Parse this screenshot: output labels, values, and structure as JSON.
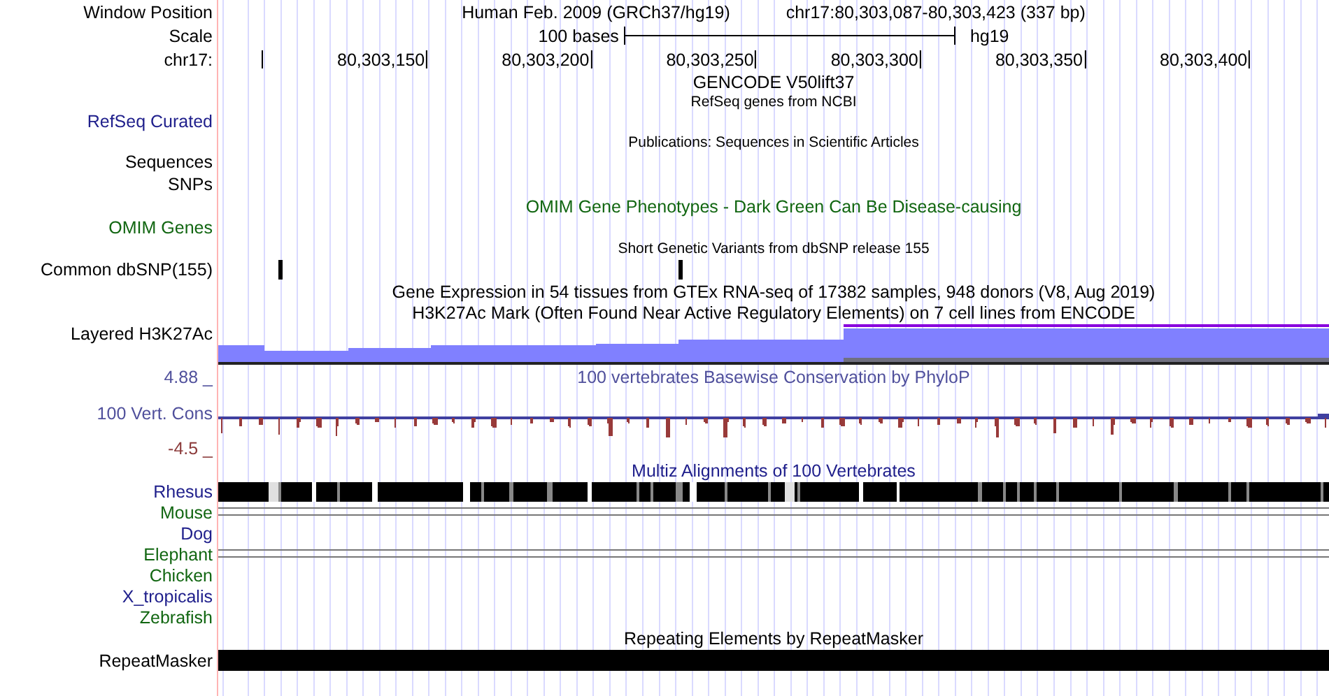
{
  "header": {
    "position_label": "Window Position",
    "assembly": "Human Feb. 2009 (GRCh37/hg19)",
    "position": "chr17:80,303,087-80,303,423 (337 bp)",
    "scale_label": "Scale",
    "scale_text": "100 bases",
    "scale_db": "hg19",
    "chrom_label": "chr17:",
    "ruler_ticks": [
      "80,303,150",
      "80,303,200",
      "80,303,250",
      "80,303,300",
      "80,303,350",
      "80,303,400"
    ]
  },
  "tracks": [
    {
      "kind": "title",
      "title": "GENCODE V50lift37"
    },
    {
      "kind": "note",
      "title": "RefSeq genes from NCBI"
    },
    {
      "kind": "label",
      "label": "RefSeq Curated",
      "color": "#20208c"
    },
    {
      "kind": "note",
      "title": "Publications: Sequences in Scientific Articles"
    },
    {
      "kind": "label",
      "label": "Sequences",
      "color": "#000000"
    },
    {
      "kind": "label",
      "label": "SNPs",
      "color": "#000000"
    },
    {
      "kind": "title",
      "title": {
        "text": "OMIM Gene Phenotypes - Dark Green Can Be Disease-causing",
        "color": "#116611"
      }
    },
    {
      "kind": "label",
      "label": "OMIM Genes",
      "color": "#116611"
    },
    {
      "kind": "note",
      "title": "Short Genetic Variants from dbSNP release 155"
    },
    {
      "kind": "snp",
      "label": "Common dbSNP(155)",
      "color": "#000000"
    },
    {
      "kind": "title",
      "title": "Gene Expression in 54 tissues from GTEx RNA-seq of 17382 samples, 948 donors (V8, Aug 2019)"
    },
    {
      "kind": "title",
      "title": "H3K27Ac Mark (Often Found Near Active Regulatory Elements) on 7 cell lines from ENCODE"
    },
    {
      "kind": "signal",
      "label": "Layered H3K27Ac",
      "color": "#000000"
    },
    {
      "kind": "label",
      "label": "4.88 _",
      "color": "#50509c",
      "title": {
        "text": "100 vertebrates Basewise Conservation by PhyloP",
        "color": "#50509c"
      }
    },
    {
      "kind": "wiggle",
      "label": "100 Vert. Cons",
      "color": "#50509c"
    },
    {
      "kind": "label",
      "label": "-4.5 _",
      "color": "#8b3a3a"
    },
    {
      "kind": "title",
      "title": {
        "text": "Multiz Alignments of 100 Vertebrates",
        "color": "#20208c"
      }
    },
    {
      "kind": "alignment",
      "label": "Rhesus",
      "color": "#20208c"
    },
    {
      "kind": "pairwise",
      "label": "Mouse",
      "color": "#116611"
    },
    {
      "kind": "species",
      "label": "Dog",
      "color": "#20208c"
    },
    {
      "kind": "pairwise",
      "label": "Elephant",
      "color": "#116611"
    },
    {
      "kind": "species",
      "label": "Chicken",
      "color": "#116611"
    },
    {
      "kind": "species",
      "label": "X_tropicalis",
      "color": "#20208c"
    },
    {
      "kind": "species",
      "label": "Zebrafish",
      "color": "#116611"
    },
    {
      "kind": "title",
      "title": "Repeating Elements by RepeatMasker"
    },
    {
      "kind": "repeat",
      "label": "RepeatMasker",
      "color": "#000000"
    }
  ]
}
